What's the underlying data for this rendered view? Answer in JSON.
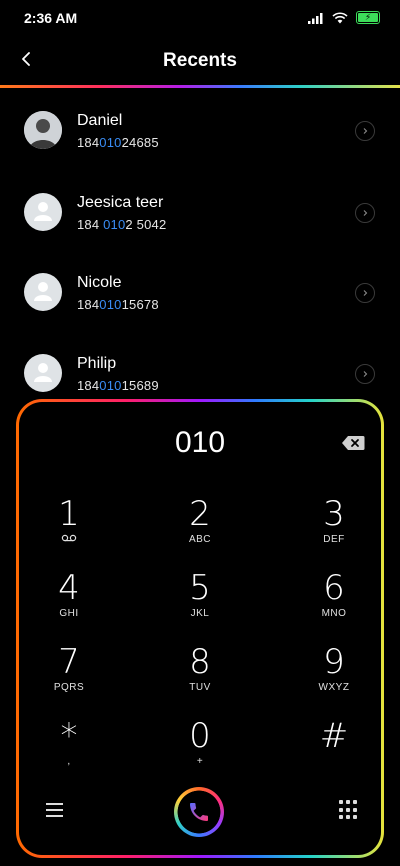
{
  "status": {
    "time": "2:36 AM"
  },
  "header": {
    "title": "Recents"
  },
  "recents": [
    {
      "name": "Daniel",
      "number_pre": "184",
      "number_hl": "010",
      "number_post": "24685"
    },
    {
      "name": "Jeesica teer",
      "number_pre": "184 ",
      "number_hl": "010",
      "number_post": "2 5042"
    },
    {
      "name": "Nicole",
      "number_pre": "184",
      "number_hl": "010",
      "number_post": "15678"
    },
    {
      "name": "Philip",
      "number_pre": "184",
      "number_hl": "010",
      "number_post": "15689"
    }
  ],
  "dialpad": {
    "input": "010",
    "keys": [
      {
        "digit": "1",
        "letters": ""
      },
      {
        "digit": "2",
        "letters": "ABC"
      },
      {
        "digit": "3",
        "letters": "DEF"
      },
      {
        "digit": "4",
        "letters": "GHI"
      },
      {
        "digit": "5",
        "letters": "JKL"
      },
      {
        "digit": "6",
        "letters": "MNO"
      },
      {
        "digit": "7",
        "letters": "PQRS"
      },
      {
        "digit": "8",
        "letters": "TUV"
      },
      {
        "digit": "9",
        "letters": "WXYZ"
      },
      {
        "digit": "*",
        "letters": ","
      },
      {
        "digit": "0",
        "letters": "+"
      },
      {
        "digit": "#",
        "letters": ""
      }
    ]
  },
  "colors": {
    "accent": "#3a8df5",
    "battery": "#3ddc5a",
    "background": "#000000"
  },
  "icons": [
    "back-arrow-icon",
    "signal-icon",
    "wifi-icon",
    "battery-icon",
    "chevron-right-icon",
    "backspace-icon",
    "voicemail-icon",
    "menu-icon",
    "phone-icon",
    "keypad-icon"
  ]
}
